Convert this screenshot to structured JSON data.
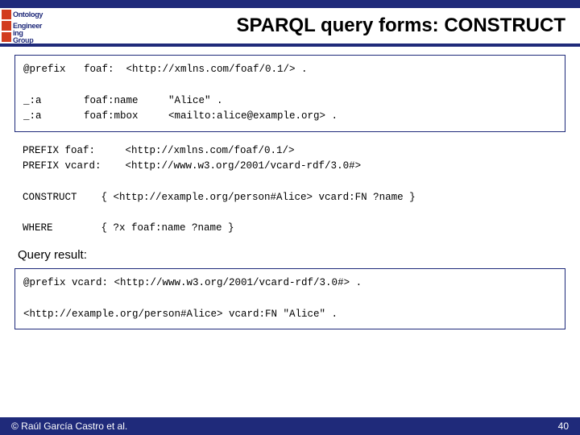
{
  "logo": {
    "line1": "Ontology",
    "line2": "Engineer",
    "line3": "ing Group"
  },
  "title": "SPARQL query forms: CONSTRUCT",
  "box1": "@prefix   foaf:  <http://xmlns.com/foaf/0.1/> .\n\n_:a       foaf:name     \"Alice\" .\n_:a       foaf:mbox     <mailto:alice@example.org> .",
  "query": "PREFIX foaf:     <http://xmlns.com/foaf/0.1/>\nPREFIX vcard:    <http://www.w3.org/2001/vcard-rdf/3.0#>\n\nCONSTRUCT    { <http://example.org/person#Alice> vcard:FN ?name }\n\nWHERE        { ?x foaf:name ?name }",
  "result_label": "Query result:",
  "box2": "@prefix vcard: <http://www.w3.org/2001/vcard-rdf/3.0#> .\n\n<http://example.org/person#Alice> vcard:FN \"Alice\" .",
  "footer": {
    "left": "© Raúl García Castro et al.",
    "right": "40"
  }
}
